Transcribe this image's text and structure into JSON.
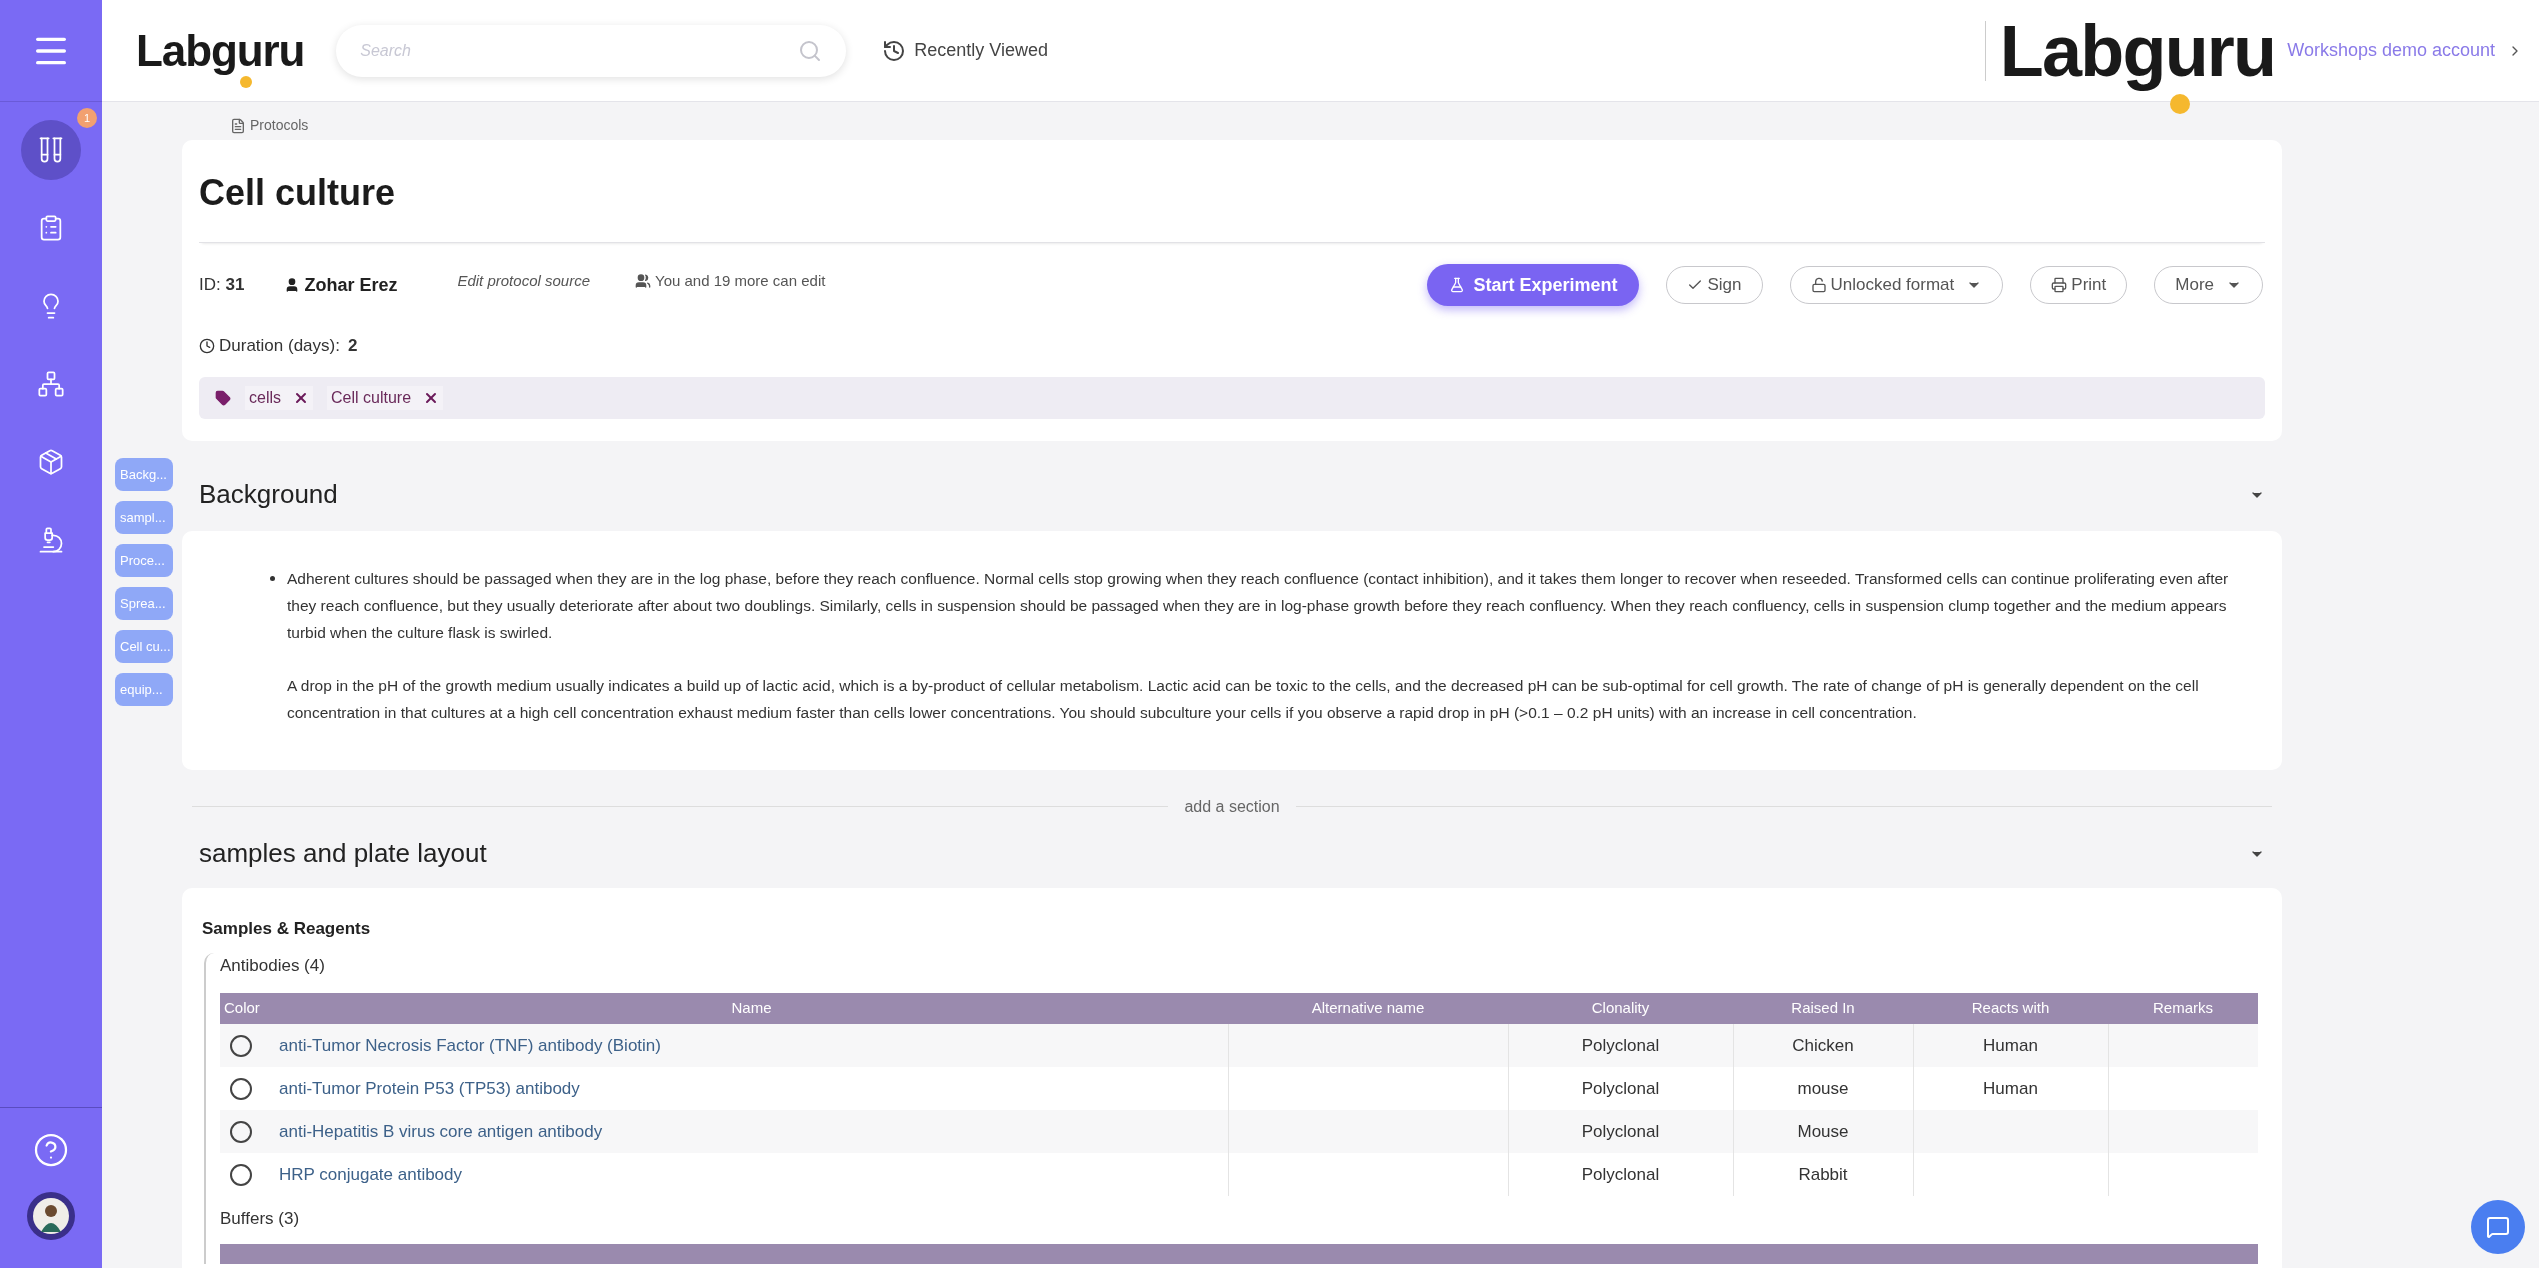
{
  "topbar": {
    "logo": "Labguru",
    "search": {
      "placeholder": "Search"
    },
    "recently_viewed": "Recently Viewed",
    "account_logo": "Labguru",
    "account": "Workshops demo account"
  },
  "sidebar": {
    "items": [
      {
        "kind": "flasks",
        "selected": true,
        "badge": "1"
      },
      {
        "kind": "clipboard",
        "selected": false
      },
      {
        "kind": "bulb",
        "selected": false
      },
      {
        "kind": "network",
        "selected": false
      },
      {
        "kind": "box",
        "selected": false
      },
      {
        "kind": "microscope",
        "selected": false
      }
    ]
  },
  "breadcrumb": "Protocols",
  "protocol": {
    "title": "Cell culture",
    "id_label": "ID:",
    "id": "31",
    "author": "Zohar Erez",
    "edit_source": "Edit protocol source",
    "editors": "You and 19 more can edit",
    "buttons": [
      {
        "kind": "primary",
        "label": "Start Experiment"
      },
      {
        "kind": "sign",
        "label": "Sign"
      },
      {
        "kind": "lock",
        "label": "Unlocked format"
      },
      {
        "kind": "print",
        "label": "Print"
      },
      {
        "kind": "more",
        "label": "More"
      }
    ],
    "duration_label": "Duration (days):",
    "duration": "2",
    "tags": [
      "cells",
      "Cell culture"
    ]
  },
  "section_nav": [
    "Backg...",
    "sampl...",
    "Proce...",
    "Sprea...",
    "Cell cu...",
    "equip..."
  ],
  "background": {
    "title": "Background",
    "paragraphs": [
      {
        "kind": "bullet",
        "text": "Adherent cultures should be passaged when they are in the log phase, before they reach confluence.  Normal cells stop growing when they reach confluence (contact inhibition), and it takes them longer to recover when reseeded.  Transformed cells can continue proliferating even after they reach confluence, but they usually deteriorate after about two doublings. Similarly, cells in suspension should be passaged when they are in log-phase growth before they reach confluency.  When they reach confluency, cells in suspension clump together and the medium appears turbid when the culture flask is swirled."
      },
      {
        "kind": "plain",
        "text": "A drop in the pH of the growth medium usually indicates a build up of lactic acid, which is a by-product of cellular metabolism.  Lactic acid can be toxic to the cells, and the decreased pH can be sub-optimal for cell growth.  The rate of change of pH is generally dependent on the cell concentration in that cultures at a high cell concentration exhaust medium faster than cells lower concentrations.  You should subculture your cells if you observe a rapid drop in pH (>0.1 – 0.2 pH units) with an increase in cell concentration."
      }
    ]
  },
  "add_section": "add a section",
  "samples": {
    "title": "samples and plate layout",
    "subtitle": "Samples & Reagents",
    "antibodies": {
      "title": "Antibodies (4)",
      "columns": [
        "Color",
        "Name",
        "Alternative name",
        "Clonality",
        "Raised In",
        "Reacts with",
        "Remarks"
      ],
      "rows": [
        {
          "selected": false,
          "name": "anti-Tumor Necrosis Factor (TNF) antibody (Biotin)",
          "clonality": "Polyclonal",
          "raised_in": "Chicken",
          "reacts_with": "Human"
        },
        {
          "selected": false,
          "name": "anti-Tumor Protein P53 (TP53) antibody",
          "clonality": "Polyclonal",
          "raised_in": "mouse",
          "reacts_with": "Human"
        },
        {
          "selected": false,
          "name": "anti-Hepatitis B virus core antigen antibody",
          "clonality": "Polyclonal",
          "raised_in": "Mouse"
        },
        {
          "selected": false,
          "name": "HRP conjugate antibody",
          "clonality": "Polyclonal",
          "raised_in": "Rabbit"
        }
      ]
    },
    "buffers": {
      "title": "Buffers (3)"
    }
  }
}
